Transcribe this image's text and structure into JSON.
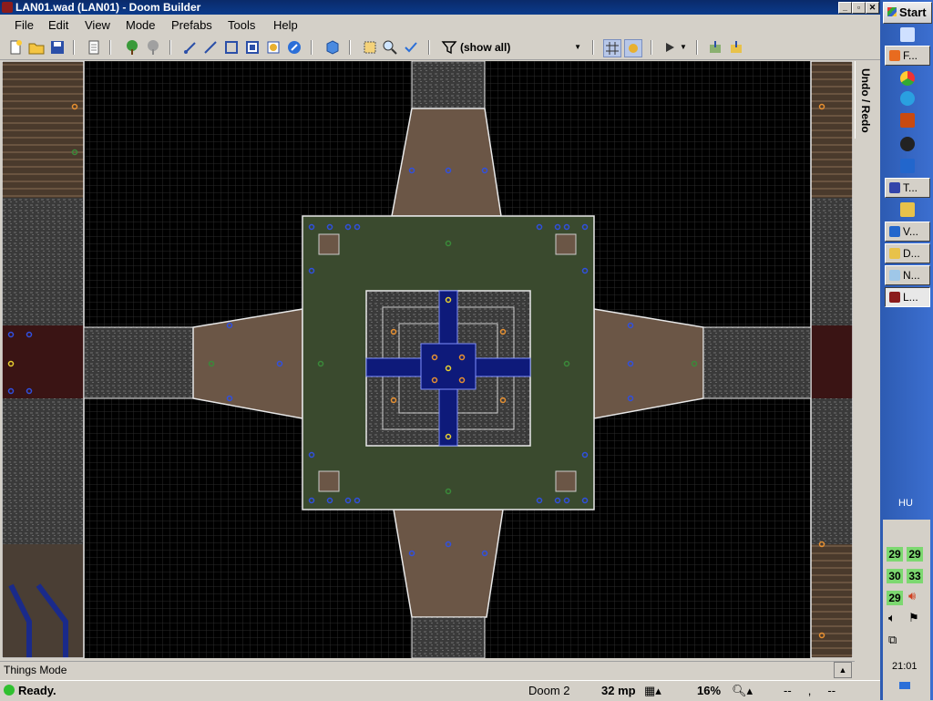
{
  "window": {
    "title": "LAN01.wad (LAN01) - Doom Builder"
  },
  "menu": [
    "File",
    "Edit",
    "View",
    "Mode",
    "Prefabs",
    "Tools",
    "Help"
  ],
  "toolbar": {
    "filter_label": "(show all)"
  },
  "side_panel": {
    "tab_label": "Undo / Redo"
  },
  "mode_bar": {
    "label": "Things Mode"
  },
  "status": {
    "text": "Ready.",
    "game": "Doom 2",
    "grid": "32 mp",
    "zoom": "16%",
    "coords": "--     ,     --"
  },
  "taskbar": {
    "start_label": "Start",
    "buttons": [
      {
        "label": "F...",
        "icon": "firefox-icon",
        "color": "#e86b1f"
      },
      {
        "label": "T...",
        "icon": "disk-icon",
        "color": "#3344aa"
      },
      {
        "label": "V...",
        "icon": "doombuilder-icon",
        "color": "#2266cc"
      },
      {
        "label": "D...",
        "icon": "folder-icon",
        "color": "#e8c24a"
      },
      {
        "label": "N...",
        "icon": "notepad-icon",
        "color": "#9fc7e8"
      },
      {
        "label": "L...",
        "icon": "doom-icon",
        "color": "#8b1c1c"
      }
    ],
    "tray_numbers": [
      "29",
      "29",
      "30",
      "33",
      "29"
    ],
    "lang": "HU",
    "clock": "21:01"
  }
}
